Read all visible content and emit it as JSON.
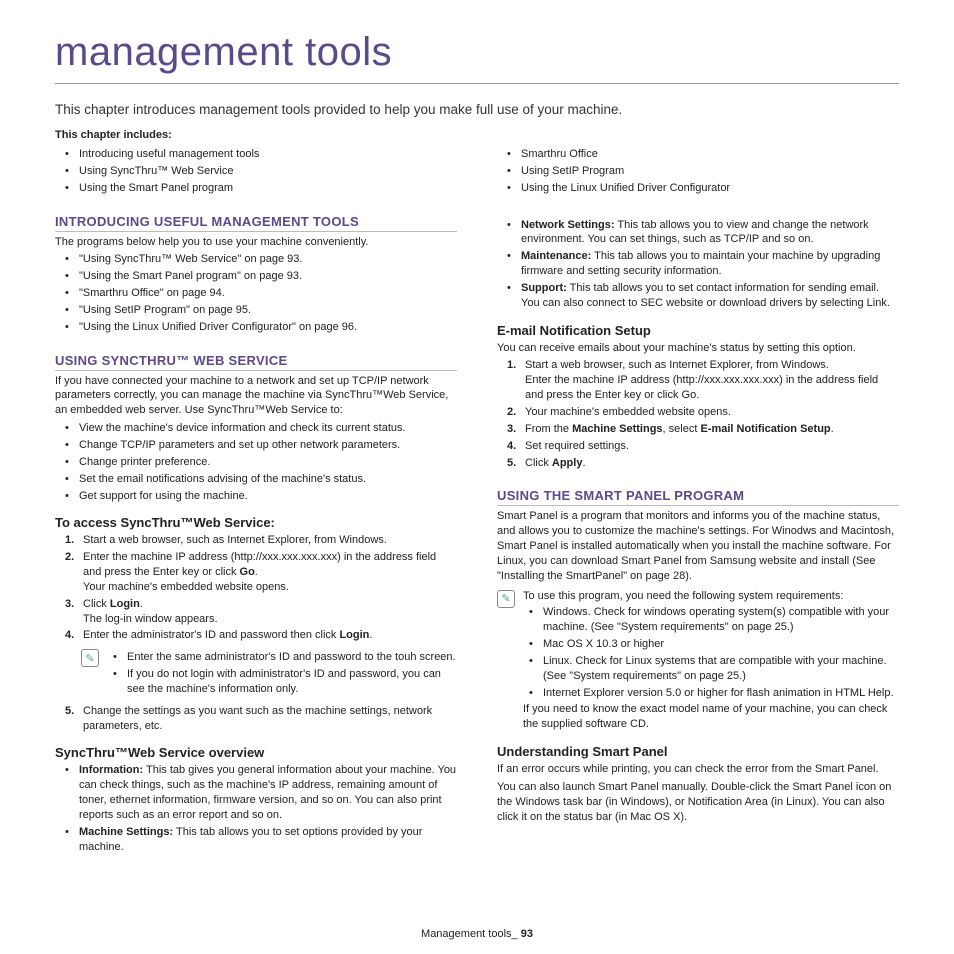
{
  "title": "management tools",
  "intro": "This chapter introduces management tools provided to help you make full use of your machine.",
  "includes_label": "This chapter includes:",
  "toc_left": [
    "Introducing useful management tools",
    "Using SyncThru™ Web Service",
    "Using the Smart Panel program"
  ],
  "toc_right": [
    "Smarthru Office",
    "Using SetIP Program",
    "Using the Linux Unified Driver Configurator"
  ],
  "s1": {
    "heading": "INTRODUCING USEFUL MANAGEMENT TOOLS",
    "lead": "The programs below help you to use your machine conveniently.",
    "items": [
      "\"Using SyncThru™ Web Service\" on page 93.",
      "\"Using the Smart Panel program\" on page 93.",
      "\"Smarthru Office\" on page 94.",
      "\"Using SetIP Program\" on page 95.",
      "\"Using the Linux Unified Driver Configurator\" on page 96."
    ]
  },
  "s2": {
    "heading": "USING SYNCTHRU™ WEB SERVICE",
    "lead": "If you have connected your machine to a network and set up TCP/IP network parameters correctly, you can manage the machine via SyncThru™Web Service, an embedded web server. Use SyncThru™Web Service to:",
    "items": [
      "View the machine's device information and check its current status.",
      "Change TCP/IP parameters and set up other network parameters.",
      "Change printer preference.",
      "Set the email notifications advising of the machine's status.",
      "Get support for using the machine."
    ],
    "access_h": "To access SyncThru™Web Service:",
    "step1": "Start a web browser, such as Internet Explorer, from Windows.",
    "step2a": "Enter the machine IP address (http://xxx.xxx.xxx.xxx) in the address field and press the Enter key or click ",
    "step2b": "Go",
    "step2c": ".",
    "step2_after": "Your machine's embedded website opens.",
    "step3a": "Click ",
    "step3b": "Login",
    "step3c": ".",
    "step3_after": "The log-in window appears.",
    "step4a": "Enter the administrator's ID and password then click ",
    "step4b": "Login",
    "step4c": ".",
    "note1": "Enter the same administrator's ID and password to the touh screen.",
    "note2": "If you do not login with administrator's ID and password, you can see the machine's information only.",
    "step5": "Change the settings as you want such as the machine settings, network parameters, etc.",
    "overview_h": "SyncThru™Web Service overview",
    "ov1a": "Information:",
    "ov1b": "  This tab gives you general information about your machine. You can check things, such as the machine's IP address, remaining amount of toner, ethernet information, firmware version, and so on. You can also print reports such as an error report and so on.",
    "ov2a": "Machine Settings:",
    "ov2b": "  This tab allows you to set options provided by your machine."
  },
  "right": {
    "ov3a": "Network Settings:",
    "ov3b": "  This tab allows you to view and change the network environment. You can set things, such as TCP/IP and so on.",
    "ov4a": "Maintenance:",
    "ov4b": "  This tab allows you to maintain your machine by upgrading firmware and setting security information.",
    "ov5a": "Support:",
    "ov5b": "  This tab allows you to set contact information for sending email. You can also connect to SEC website or download drivers by selecting Link.",
    "email_h": "E-mail Notification Setup",
    "email_lead": "You can receive emails about your machine's status by setting this option.",
    "e1": "Start a web browser, such as Internet Explorer, from Windows.",
    "e1b": "Enter the machine IP address (http://xxx.xxx.xxx.xxx) in the address field and press the Enter key or click Go.",
    "e2": "Your machine's embedded website opens.",
    "e3a": "From the ",
    "e3b": "Machine Settings",
    "e3c": ", select ",
    "e3d": "E-mail Notification Setup",
    "e3e": ".",
    "e4": "Set required settings.",
    "e5a": "Click ",
    "e5b": "Apply",
    "e5c": "."
  },
  "s3": {
    "heading": "USING THE SMART PANEL PROGRAM",
    "lead": "Smart Panel is a program that monitors and informs you of the machine status, and allows you to customize the machine's settings. For Winodws and Macintosh, Smart Panel is installed automatically when you install the machine software. For Linux, you can download Smart Panel from Samsung website and install (See \"Installing the SmartPanel\" on page 28).",
    "note_lead": "To use this program, you need the following system requirements:",
    "note_items": [
      "Windows. Check for windows operating system(s) compatible with your machine. (See \"System requirements\" on page 25.)",
      "Mac OS X 10.3 or higher",
      "Linux. Check for Linux systems that are compatible with your machine. (See \"System requirements\" on page 25.)",
      "Internet Explorer version 5.0 or higher for flash animation in HTML Help."
    ],
    "note_tail": "If you need to know the exact model name of your machine, you can check the supplied software CD.",
    "under_h": "Understanding Smart Panel",
    "under_p1": "If an error occurs while printing,  you can check the error from the Smart Panel.",
    "under_p2": "You can also launch Smart Panel manually. Double-click the Smart Panel icon on the Windows task bar (in Windows), or Notification Area (in Linux). You can also click it on the status bar (in Mac OS X)."
  },
  "footer_a": "Management tools",
  "footer_b": "_ ",
  "footer_c": "93"
}
